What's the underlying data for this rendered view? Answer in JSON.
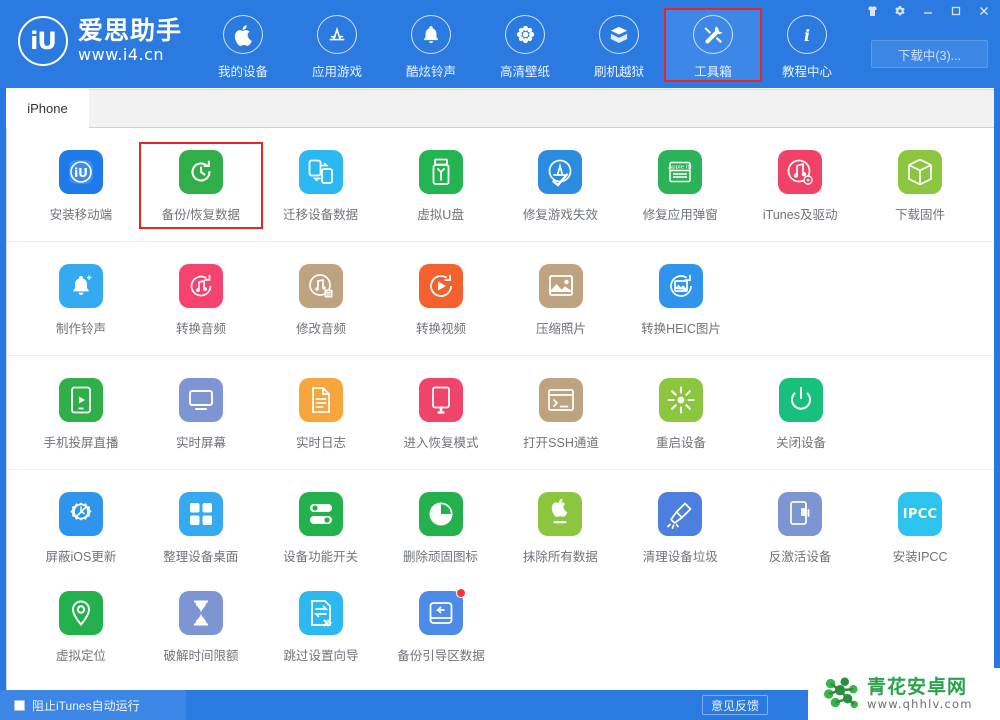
{
  "window": {
    "controls": [
      {
        "name": "skin-icon",
        "glyph": "skin"
      },
      {
        "name": "settings-icon",
        "glyph": "gear"
      },
      {
        "name": "minimize-button",
        "glyph": "minimize"
      },
      {
        "name": "maximize-button",
        "glyph": "maximize"
      },
      {
        "name": "close-button",
        "glyph": "close"
      }
    ]
  },
  "brand": {
    "logo_text": "iU",
    "name": "爱思助手",
    "url": "www.i4.cn"
  },
  "nav": {
    "items": [
      {
        "label": "我的设备",
        "icon": "apple-icon",
        "active": false,
        "highlighted": false
      },
      {
        "label": "应用游戏",
        "icon": "appstore-icon",
        "active": false,
        "highlighted": false
      },
      {
        "label": "酷炫铃声",
        "icon": "bell-icon",
        "active": false,
        "highlighted": false
      },
      {
        "label": "高清壁纸",
        "icon": "flower-icon",
        "active": false,
        "highlighted": false
      },
      {
        "label": "刷机越狱",
        "icon": "box-open-icon",
        "active": false,
        "highlighted": false
      },
      {
        "label": "工具箱",
        "icon": "tools-icon",
        "active": true,
        "highlighted": true
      },
      {
        "label": "教程中心",
        "icon": "info-icon",
        "active": false,
        "highlighted": false
      }
    ],
    "download_button": "下载中(3)..."
  },
  "tabs": [
    {
      "label": "iPhone",
      "active": true
    }
  ],
  "toolbox": {
    "rows": [
      {
        "separator": true,
        "cells": [
          {
            "label": "安装移动端",
            "icon": "i4-app-icon",
            "color": "#1e7ae8",
            "highlighted": false
          },
          {
            "label": "备份/恢复数据",
            "icon": "backup-restore-icon",
            "color": "#2fae4a",
            "highlighted": true
          },
          {
            "label": "迁移设备数据",
            "icon": "device-migrate-icon",
            "color": "#2cb8f0",
            "highlighted": false
          },
          {
            "label": "虚拟U盘",
            "icon": "usb-drive-icon",
            "color": "#23b351",
            "highlighted": false
          },
          {
            "label": "修复游戏失效",
            "icon": "appstore-fix-icon",
            "color": "#2c8ce0",
            "highlighted": false
          },
          {
            "label": "修复应用弹窗",
            "icon": "apple-id-icon",
            "color": "#2bb457",
            "highlighted": false
          },
          {
            "label": "iTunes及驱动",
            "icon": "itunes-driver-icon",
            "color": "#f04267",
            "highlighted": false
          },
          {
            "label": "下载固件",
            "icon": "firmware-cube-icon",
            "color": "#8cc63f",
            "highlighted": false
          }
        ]
      },
      {
        "separator": true,
        "cells": [
          {
            "label": "制作铃声",
            "icon": "ringtone-make-icon",
            "color": "#35aaf0",
            "highlighted": false
          },
          {
            "label": "转换音频",
            "icon": "audio-convert-icon",
            "color": "#f5426f",
            "highlighted": false
          },
          {
            "label": "修改音频",
            "icon": "audio-edit-icon",
            "color": "#bda380",
            "highlighted": false
          },
          {
            "label": "转换视频",
            "icon": "video-convert-icon",
            "color": "#f4612f",
            "highlighted": false
          },
          {
            "label": "压缩照片",
            "icon": "photo-compress-icon",
            "color": "#bda380",
            "highlighted": false
          },
          {
            "label": "转换HEIC图片",
            "icon": "heic-convert-icon",
            "color": "#2f95ec",
            "highlighted": false
          }
        ]
      },
      {
        "separator": true,
        "cells": [
          {
            "label": "手机投屏直播",
            "icon": "screen-cast-icon",
            "color": "#2fae4a",
            "highlighted": false
          },
          {
            "label": "实时屏幕",
            "icon": "live-screen-icon",
            "color": "#7e95d4",
            "highlighted": false
          },
          {
            "label": "实时日志",
            "icon": "live-log-icon",
            "color": "#f6a63c",
            "highlighted": false
          },
          {
            "label": "进入恢复模式",
            "icon": "recovery-mode-icon",
            "color": "#f0456b",
            "highlighted": false
          },
          {
            "label": "打开SSH通道",
            "icon": "ssh-terminal-icon",
            "color": "#bda380",
            "highlighted": false
          },
          {
            "label": "重启设备",
            "icon": "reboot-icon",
            "color": "#8cc63f",
            "highlighted": false
          },
          {
            "label": "关闭设备",
            "icon": "power-off-icon",
            "color": "#17c07b",
            "highlighted": false
          }
        ]
      },
      {
        "separator": false,
        "cells": [
          {
            "label": "屏蔽iOS更新",
            "icon": "block-ios-update-icon",
            "color": "#2f95ec",
            "highlighted": false
          },
          {
            "label": "整理设备桌面",
            "icon": "organize-desktop-icon",
            "color": "#35aaf0",
            "highlighted": false
          },
          {
            "label": "设备功能开关",
            "icon": "feature-toggle-icon",
            "color": "#22b14c",
            "highlighted": false
          },
          {
            "label": "删除顽固图标",
            "icon": "delete-icon-icon",
            "color": "#22b14c",
            "highlighted": false
          },
          {
            "label": "抹除所有数据",
            "icon": "erase-all-icon",
            "color": "#8cc63f",
            "highlighted": false
          },
          {
            "label": "清理设备垃圾",
            "icon": "clean-junk-icon",
            "color": "#4c7fe0",
            "highlighted": false
          },
          {
            "label": "反激活设备",
            "icon": "deactivate-icon",
            "color": "#7e95d4",
            "highlighted": false
          },
          {
            "label": "安装IPCC",
            "icon": "ipcc-install-icon",
            "color": "#2cc3ee",
            "highlighted": false,
            "text": "IPCC"
          }
        ]
      },
      {
        "separator": false,
        "cells": [
          {
            "label": "虚拟定位",
            "icon": "virtual-location-icon",
            "color": "#22b14c",
            "highlighted": false
          },
          {
            "label": "破解时间限额",
            "icon": "screen-time-crack-icon",
            "color": "#7e95d4",
            "highlighted": false
          },
          {
            "label": "跳过设置向导",
            "icon": "skip-setup-icon",
            "color": "#2cb8f0",
            "highlighted": false
          },
          {
            "label": "备份引导区数据",
            "icon": "backup-boot-icon",
            "color": "#4c8ce8",
            "highlighted": false,
            "badge": true
          }
        ]
      }
    ]
  },
  "bottom": {
    "checkbox_label": "阻止iTunes自动运行",
    "checkbox_checked": false,
    "feedback_button": "意见反馈"
  },
  "watermark": {
    "name": "青花安卓网",
    "url": "www.qhhlv.com"
  },
  "colors": {
    "header_blue": "#2b7ae0",
    "active_nav": "#3d87e6",
    "highlight_red": "#ee2222",
    "label_gray": "#6f7379",
    "watermark_green": "#2aa14b"
  }
}
